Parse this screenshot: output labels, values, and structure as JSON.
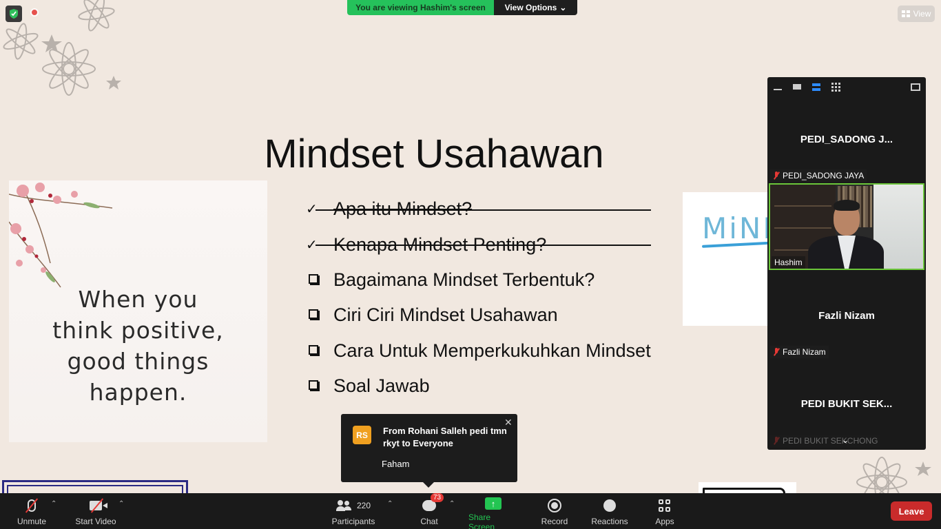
{
  "top": {
    "viewing_message": "You are viewing Hashim's screen",
    "view_options_label": "View Options",
    "view_button_label": "View"
  },
  "slide": {
    "title": "Mindset Usahawan",
    "quote": [
      "When you",
      "think positive,",
      "good things",
      "happen."
    ],
    "bullets": [
      {
        "text": "Apa itu Mindset?",
        "done": true
      },
      {
        "text": "Kenapa Mindset Penting?",
        "done": true
      },
      {
        "text": "Bagaimana Mindset Terbentuk?",
        "done": false
      },
      {
        "text": "Ciri Ciri Mindset Usahawan",
        "done": false
      },
      {
        "text": "Cara Untuk Memperkukuhkan Mindset",
        "done": false
      },
      {
        "text": "Soal Jawab",
        "done": false
      }
    ],
    "side_image_text": "MiND"
  },
  "participants_panel": {
    "tiles": [
      {
        "display_name": "PEDI_SADONG  J...",
        "label": "PEDI_SADONG JAYA",
        "muted": true,
        "video": false
      },
      {
        "display_name": "",
        "label": "Hashim",
        "muted": false,
        "video": true
      },
      {
        "display_name": "Fazli Nizam",
        "label": "Fazli Nizam",
        "muted": true,
        "video": false
      },
      {
        "display_name": "PEDI BUKIT SEK...",
        "label": "PEDI BUKIT SEKCHONG",
        "muted": true,
        "video": false
      }
    ]
  },
  "chat_toast": {
    "avatar_initials": "RS",
    "from": "From Rohani Salleh pedi tmn rkyt to Everyone",
    "message": "Faham"
  },
  "toolbar": {
    "unmute_label": "Unmute",
    "start_video_label": "Start Video",
    "participants_label": "Participants",
    "participants_count": "220",
    "chat_label": "Chat",
    "chat_badge": "73",
    "share_screen_label": "Share Screen",
    "record_label": "Record",
    "reactions_label": "Reactions",
    "apps_label": "Apps",
    "leave_label": "Leave"
  },
  "colors": {
    "slide_bg": "#f1e8e0",
    "viewing_green": "#25c15b",
    "active_speaker_border": "#6bc63a",
    "leave_red": "#c92b2b",
    "badge_red": "#e53935"
  }
}
